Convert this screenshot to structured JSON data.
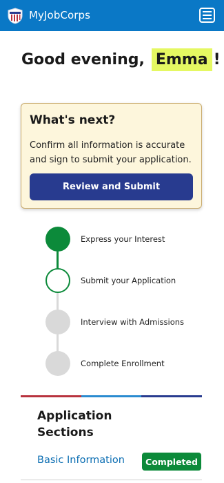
{
  "header": {
    "app_title": "MyJobCorps",
    "logo_icon": "job-corps-shield-icon",
    "menu_icon": "hamburger-menu-icon",
    "bar_color": "#0a78c6"
  },
  "greeting": {
    "prefix": "Good evening,",
    "name": "Emma",
    "suffix": "!",
    "highlight_color": "#e5f862"
  },
  "whats_next": {
    "title": "What's next?",
    "body": "Confirm all information is accurate and sign to submit your application.",
    "button_label": "Review and Submit",
    "button_color": "#283b8f"
  },
  "steps": [
    {
      "label": "Express your Interest",
      "status": "complete"
    },
    {
      "label": "Submit your Application",
      "status": "current"
    },
    {
      "label": "Interview with Admissions",
      "status": "upcoming"
    },
    {
      "label": "Complete Enrollment",
      "status": "upcoming"
    }
  ],
  "step_colors": {
    "complete": "#0c8a3a",
    "upcoming": "#d9d9d9"
  },
  "divider_colors": [
    "#b8323e",
    "#2a8bd0",
    "#283b8f"
  ],
  "sections": {
    "title": "Application Sections",
    "items": [
      {
        "label": "Basic Information",
        "badge": "Completed",
        "badge_color": "#0c8a3a"
      }
    ]
  }
}
